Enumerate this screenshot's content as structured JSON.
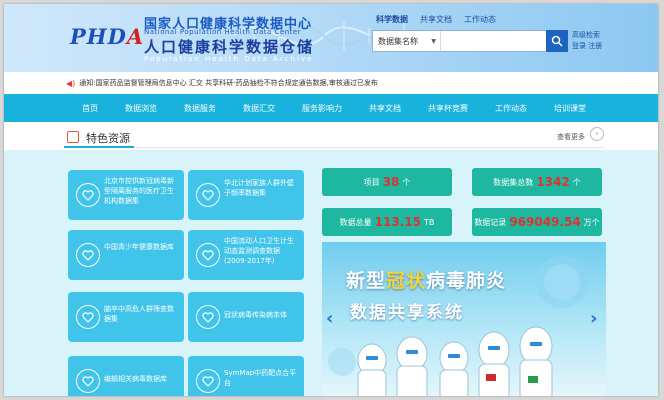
{
  "header": {
    "logo_main": "PHD",
    "logo_accent": "A",
    "title_cn_1": "国家人口健康科学数据中心",
    "title_en_1": "National Population Health Data Center",
    "title_cn_2": "人口健康科学数据仓储",
    "title_en_2": "Population Health Data Archive",
    "toplinks": [
      "科学数据",
      "共享文档",
      "工作动态"
    ],
    "search": {
      "scope": "数据集名称",
      "placeholder": ""
    },
    "user": {
      "line1": "高级检索",
      "line2": "登录 注册"
    }
  },
  "notice": {
    "text": "通知:国家药品监督管理局信息中心 汇交 共享科研-药品抽检不符合规定通告数据,审核通过已发布"
  },
  "nav": {
    "items": [
      "首页",
      "数据浏览",
      "数据服务",
      "数据汇交",
      "服务影响力",
      "共享文档",
      "共享杯竞赛",
      "工作动态",
      "培训课堂"
    ]
  },
  "section": {
    "title": "特色资源",
    "more": "查看更多"
  },
  "cards": [
    {
      "label": "北京市控供新冠病毒新型隔离服务的医疗卫生机构数据集"
    },
    {
      "label": "华北计划家族人群外壁子频率数据集"
    },
    {
      "label": "中国青少年健康数据库"
    },
    {
      "label": "中国流动人口卫生计生动态监测调查数据(2009-2017年)"
    },
    {
      "label": "脑卒中高危人群筛查数据集"
    },
    {
      "label": "冠状病毒传染病本体"
    },
    {
      "label": "编辑相关病毒数据库"
    },
    {
      "label": "SymMap中药靶点合平台"
    }
  ],
  "stats": [
    {
      "label": "项目",
      "value": "38",
      "unit": "个"
    },
    {
      "label": "数据集总数",
      "value": "1342",
      "unit": "个"
    },
    {
      "label": "数据总量",
      "value": "113.15",
      "unit": "TB"
    },
    {
      "label": "数据记录",
      "value": "969049.54",
      "unit": "万个"
    }
  ],
  "banner": {
    "line1_normal": "新型",
    "line1_highlight": "冠状",
    "line1_rest": "病毒肺炎",
    "line2": "数据共享系统"
  },
  "colors": {
    "nav_bg": "#18b2dc",
    "card_bg": "#40c4ea",
    "stat_bg": "#1eb8a1",
    "stat_num": "#e03131",
    "content_bg": "#d9f3fb"
  },
  "icons": {
    "search": "search-icon",
    "card": "heart-icon",
    "arrow_left": "chevron-left-icon",
    "arrow_right": "chevron-right-icon"
  }
}
